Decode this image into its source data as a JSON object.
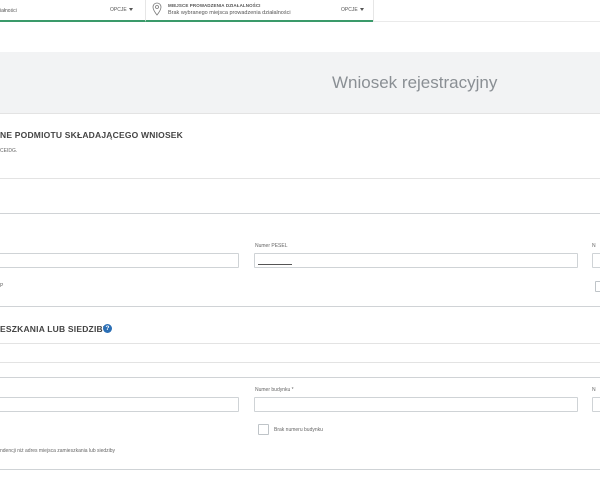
{
  "topbar": {
    "left_text": "iałności",
    "options_label_1": "OPCJE",
    "location_label": "MIEJSCE PROWADZENIA DZIAŁALNOŚCI",
    "location_value": "Brak wybranego miejsca prowadzenia działalności",
    "options_label_2": "OPCJE"
  },
  "banner": {
    "title": "Wniosek rejestracyjny"
  },
  "section_applicant": {
    "title": "NE PODMIOTU SKŁADAJĄCEGO WNIOSEK",
    "subtitle": "CEIDG.",
    "pesel_label": "Numer PESEL",
    "pesel_value": "",
    "right_label_fragment": "N",
    "small_fragment": "P"
  },
  "section_address": {
    "title": "ESZKANIA LUB SIEDZIBY",
    "help_glyph": "?",
    "building_label": "Numer budynku *",
    "right_label_fragment": "N",
    "no_building_label": "Brak numeru budynku",
    "footer_fragment": "ndencji niż adres miejsca zamieszkania lub siedziby"
  },
  "colors": {
    "accent_green": "#3a9a6a",
    "help_blue": "#2b6fb5",
    "banner_bg": "#f2f3f4"
  }
}
